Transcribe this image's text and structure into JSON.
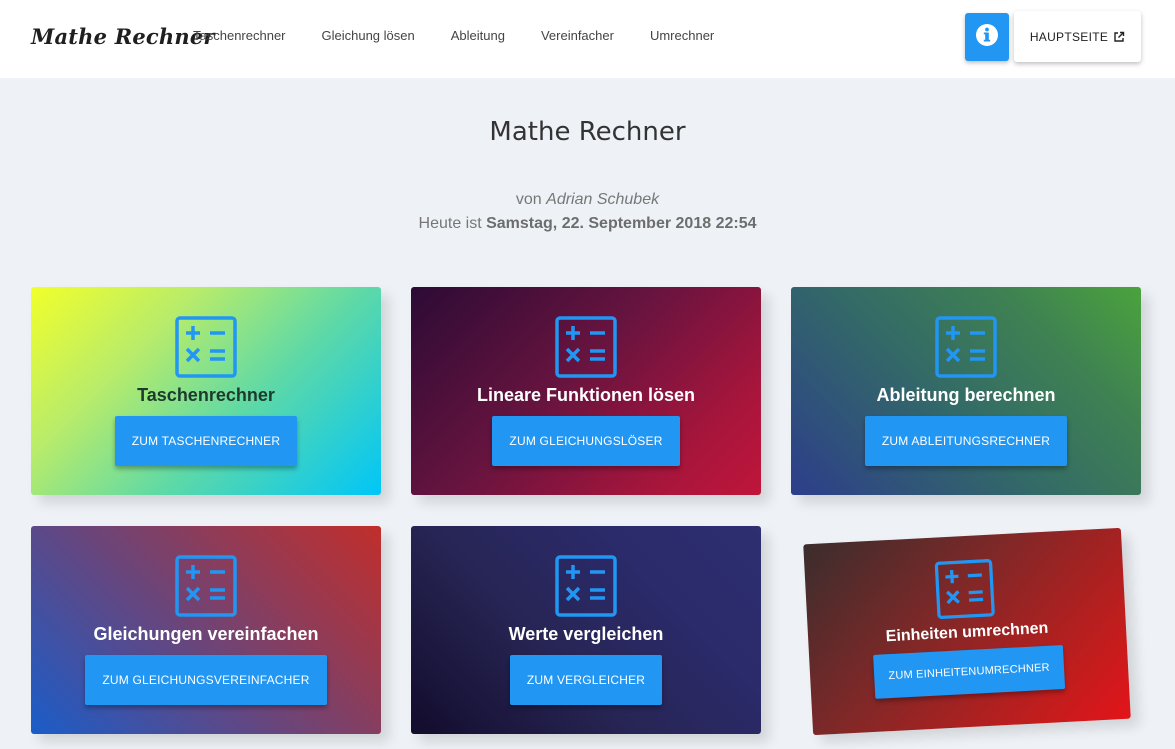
{
  "navbar": {
    "brand": "Mathe Rechner",
    "links": [
      "Taschenrechner",
      "Gleichung lösen",
      "Ableitung",
      "Vereinfacher",
      "Umrechner"
    ],
    "home_label": "HAUPTSEITE"
  },
  "header": {
    "title": "Mathe Rechner",
    "by_prefix": "von",
    "author": "Adrian Schubek",
    "date_prefix": "Heute ist",
    "date": "Samstag, 22. September 2018 22:54"
  },
  "cards": [
    {
      "title": "Taschenrechner",
      "button": "ZUM TASCHENRECHNER"
    },
    {
      "title": "Lineare Funktionen lösen",
      "button": "ZUM GLEICHUNGSLÖSER"
    },
    {
      "title": "Ableitung berechnen",
      "button": "ZUM ABLEITUNGSRECHNER"
    },
    {
      "title": "Gleichungen vereinfachen",
      "button": "ZUM GLEICHUNGSVEREINFACHER"
    },
    {
      "title": "Werte vergleichen",
      "button": "ZUM VERGLEICHER"
    },
    {
      "title": "Einheiten umrechnen",
      "button": "ZUM EINHEITENUMRECHNER"
    }
  ],
  "icons": {
    "card_icon": "calculator-icon",
    "info": "info-icon",
    "external": "external-link-icon"
  },
  "colors": {
    "accent": "#2196f3",
    "background": "#eef2f6"
  }
}
